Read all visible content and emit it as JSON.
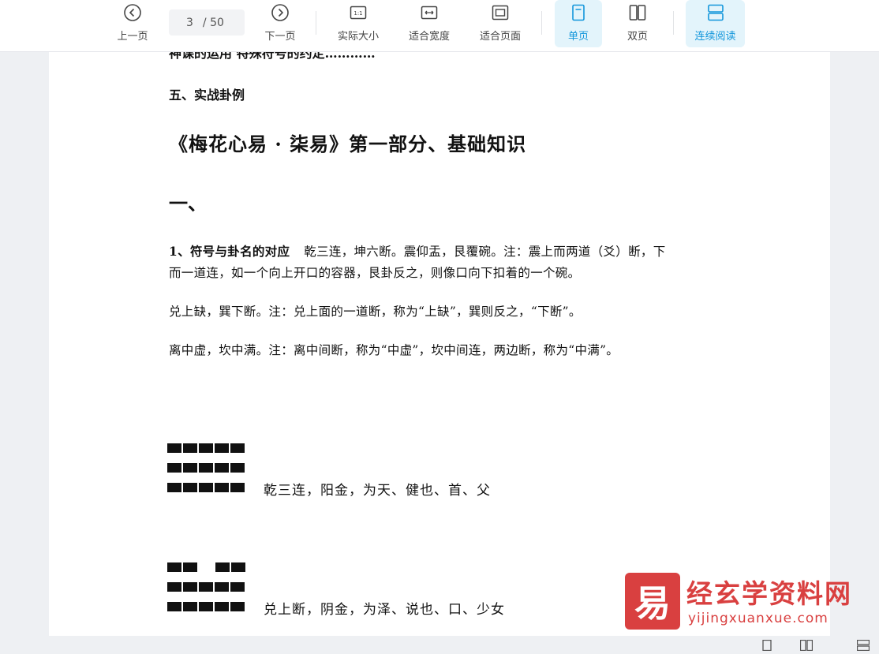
{
  "toolbar": {
    "prev_label": "上一页",
    "current_page": "3",
    "total_pages": "/ 50",
    "next_label": "下一页",
    "actual_size_label": "实际大小",
    "fit_width_label": "适合宽度",
    "fit_page_label": "适合页面",
    "single_page_label": "单页",
    "double_page_label": "双页",
    "continuous_label": "连续阅读",
    "accent_color": "#1296db",
    "active_bg": "#e3f4fb"
  },
  "document": {
    "cut_line": "神课的运用   特殊符号的约定…………",
    "section_five": "五、实战卦例",
    "main_title": "《梅花心易 · 柒易》第一部分、基础知识",
    "numeral_one": "一、",
    "para1_lead": "1、符号与卦名的对应",
    "para1_rest": "乾三连，坤六断。震仰盂，艮覆碗。注：震上而两道（爻）断，下",
    "para1_line2": "而一道连，如一个向上开口的容器，艮卦反之，则像口向下扣着的一个碗。",
    "para2": "兑上缺，巽下断。注：兑上面的一道断，称为“上缺”，巽则反之，“下断”。",
    "para3": "离中虚，坎中满。注：离中间断，称为“中虚”，坎中间连，两边断，称为“中满”。",
    "gua_qian_label": "乾三连，阳金，为天、健也、首、父",
    "gua_dui_label": "兑上断，阴金，为泽、说也、口、少女",
    "gua_qian_lines": [
      "solid",
      "solid",
      "solid"
    ],
    "gua_dui_lines": [
      "broken",
      "solid",
      "solid"
    ]
  },
  "watermark": {
    "seal_glyph": "易",
    "title": "经玄学资料网",
    "subtitle": "yijingxuanxue.com",
    "color": "#d94040"
  }
}
